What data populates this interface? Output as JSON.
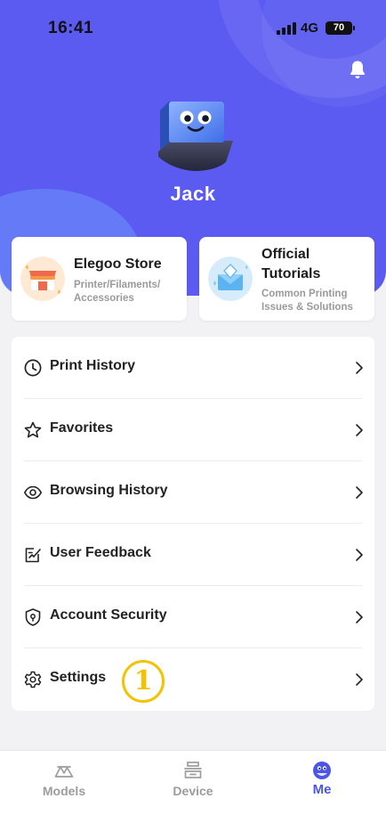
{
  "status_bar": {
    "time": "16:41",
    "network": "4G",
    "battery": "70"
  },
  "profile": {
    "name": "Jack"
  },
  "cards": [
    {
      "title": "Elegoo Store",
      "subtitle_line1": "Printer/Filaments/",
      "subtitle_line2": "Accessories",
      "icon": "store-icon"
    },
    {
      "title_line1": "Official",
      "title_line2": "Tutorials",
      "subtitle_line1": "Common Printing",
      "subtitle_line2": "Issues & Solutions",
      "icon": "tutorial-mail-icon"
    }
  ],
  "menu": [
    {
      "label": "Print History",
      "icon": "clock-icon"
    },
    {
      "label": "Favorites",
      "icon": "star-icon"
    },
    {
      "label": "Browsing History",
      "icon": "eye-icon"
    },
    {
      "label": "User Feedback",
      "icon": "feedback-icon"
    },
    {
      "label": "Account Security",
      "icon": "shield-icon"
    },
    {
      "label": "Settings",
      "icon": "gear-icon"
    }
  ],
  "annotation_badge": "1",
  "tabs": [
    {
      "label": "Models",
      "icon": "models-icon",
      "active": false
    },
    {
      "label": "Device",
      "icon": "printer-icon",
      "active": false
    },
    {
      "label": "Me",
      "icon": "me-icon",
      "active": true
    }
  ],
  "colors": {
    "hero": "#5b5bf2",
    "accent": "#4b56e6",
    "badge": "#f2c300"
  }
}
